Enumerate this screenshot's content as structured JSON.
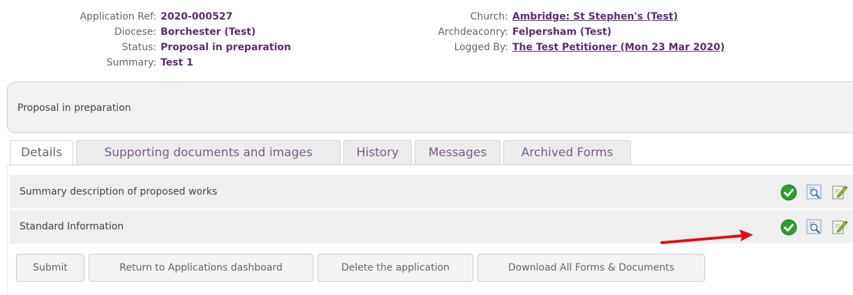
{
  "application": {
    "left_fields": [
      {
        "label": "Application Ref:",
        "value": "2020-000527"
      },
      {
        "label": "Diocese:",
        "value": "Borchester (Test)"
      },
      {
        "label": "Status:",
        "value": "Proposal in preparation"
      },
      {
        "label": "Summary:",
        "value": "Test 1"
      }
    ],
    "right_fields": [
      {
        "label": "Church:",
        "value": "Ambridge: St Stephen's (Test)"
      },
      {
        "label": "Archdeaconry:",
        "value": "Felpersham (Test)"
      },
      {
        "label": "Logged By:",
        "value": "The Test Petitioner (Mon 23 Mar 2020)"
      }
    ]
  },
  "status_panel": {
    "text": "Proposal in preparation"
  },
  "tabs": [
    {
      "label": "Details",
      "active": true
    },
    {
      "label": "Supporting documents and images",
      "active": false
    },
    {
      "label": "History",
      "active": false
    },
    {
      "label": "Messages",
      "active": false
    },
    {
      "label": "Archived Forms",
      "active": false
    }
  ],
  "form_rows": [
    {
      "label": "Summary description of proposed works",
      "icons": [
        "check-complete-icon",
        "view-form-icon",
        "edit-form-icon"
      ]
    },
    {
      "label": "Standard Information",
      "icons": [
        "check-complete-icon",
        "view-form-icon",
        "edit-form-icon"
      ]
    }
  ],
  "actions": {
    "submit": "Submit",
    "return_dashboard": "Return to Applications dashboard",
    "delete": "Delete the application",
    "download_all": "Download All Forms & Documents"
  },
  "colors": {
    "value_text": "#5b2e6e",
    "tab_text": "#7a5c86",
    "check_green": "#2e9e2e",
    "annotation_arrow": "#e01010"
  }
}
